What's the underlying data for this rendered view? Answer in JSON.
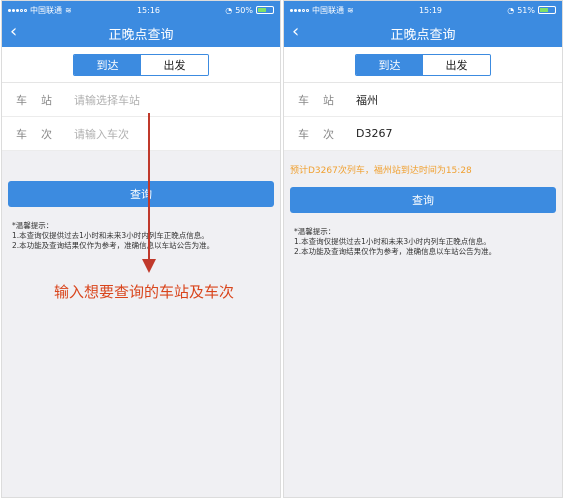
{
  "phone1": {
    "status": {
      "carrier": "中国联通",
      "time": "15:16",
      "battery": "50%",
      "battery_fraction": 0.5
    },
    "nav": {
      "back_icon": "‹",
      "title": "正晚点查询"
    },
    "tabs": {
      "arrive": "到达",
      "depart": "出发"
    },
    "station": {
      "label": "车站",
      "value": "请输选择车站"
    },
    "train": {
      "label": "车次",
      "value": "请输入车次"
    },
    "button": "查询",
    "tips": {
      "header": "*温馨提示：",
      "line1": "1.本查询仅提供过去1小时和未来3小时内列车正晚点信息。",
      "line2": "2.本功能及查询结果仅作为参考，准确信息以车站公告为准。"
    },
    "annotation": "输入想要查询的车站及车次"
  },
  "phone2": {
    "status": {
      "carrier": "中国联通",
      "time": "15:19",
      "battery": "51%",
      "battery_fraction": 0.51
    },
    "nav": {
      "back_icon": "‹",
      "title": "正晚点查询"
    },
    "tabs": {
      "arrive": "到达",
      "depart": "出发"
    },
    "station": {
      "label": "车站",
      "value": "福州"
    },
    "train": {
      "label": "车次",
      "value": "D3267"
    },
    "notice": "预计D3267次列车，福州站到达时间为15:28",
    "button": "查询",
    "tips": {
      "header": "*温馨提示：",
      "line1": "1.本查询仅提供过去1小时和未来3小时内列车正晚点信息。",
      "line2": "2.本功能及查询结果仅作为参考，准确信息以车站公告为准。"
    }
  },
  "colors": {
    "primary": "#3c8be0",
    "notice": "#f0a030",
    "annotation": "#d9451c"
  }
}
